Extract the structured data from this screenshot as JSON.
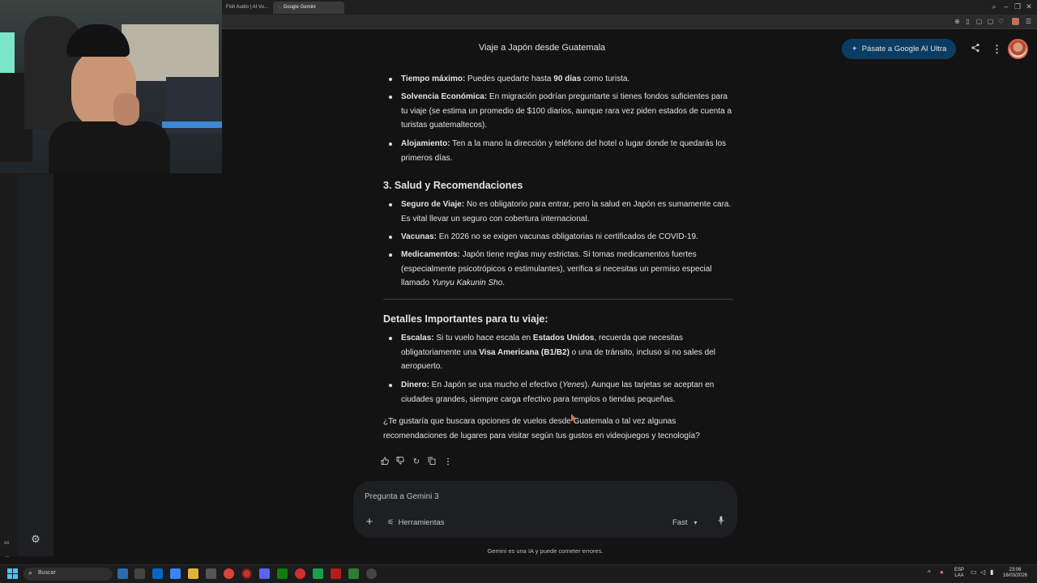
{
  "browser": {
    "tabs": [
      {
        "label": "Fish Audio | AI Vo..."
      },
      {
        "label": "Google Gemini"
      }
    ]
  },
  "header": {
    "conversation_title": "Viaje a Japón desde Guatemala",
    "upgrade_label": "Pásate a Google AI Ultra"
  },
  "content": {
    "bullets_a": [
      {
        "strong": "Tiempo máximo:",
        "pre": " Puedes quedarte hasta ",
        "strong2": "90 días",
        "post": " como turista."
      },
      {
        "strong": "Solvencia Económica:",
        "text": " En migración podrían preguntarte si tienes fondos suficientes para tu viaje (se estima un promedio de $100 diarios, aunque rara vez piden estados de cuenta a turistas guatemaltecos)."
      },
      {
        "strong": "Alojamiento:",
        "text": " Ten a la mano la dirección y teléfono del hotel o lugar donde te quedarás los primeros días."
      }
    ],
    "section3_title": "3. Salud y Recomendaciones",
    "bullets_b": [
      {
        "strong": "Seguro de Viaje:",
        "text": " No es obligatorio para entrar, pero la salud en Japón es sumamente cara. Es vital llevar un seguro con cobertura internacional."
      },
      {
        "strong": "Vacunas:",
        "text": " En 2026 no se exigen vacunas obligatorias ni certificados de COVID-19."
      },
      {
        "strong": "Medicamentos:",
        "text": " Japón tiene reglas muy estrictas. Si tomas medicamentos fuertes (especialmente psicotrópicos o estimulantes), verifica si necesitas un permiso especial llamado ",
        "em": "Yunyu Kakunin Sho",
        "post": "."
      }
    ],
    "details_title": "Detalles Importantes para tu viaje:",
    "bullets_c": [
      {
        "strong": "Escalas:",
        "pre": " Si tu vuelo hace escala en ",
        "strong2": "Estados Unidos",
        "mid": ", recuerda que necesitas obligatoriamente una ",
        "strong3": "Visa Americana (B1/B2)",
        "post": " o una de tránsito, incluso si no sales del aeropuerto."
      },
      {
        "strong": "Dinero:",
        "pre": " En Japón se usa mucho el efectivo (",
        "em": "Yenes",
        "post": "). Aunque las tarjetas se aceptan en ciudades grandes, siempre carga efectivo para templos o tiendas pequeñas."
      }
    ],
    "closing": "¿Te gustaría que buscara opciones de vuelos desde Guatemala o tal vez algunas recomendaciones de lugares para visitar según tus gustos en videojuegos y tecnología?"
  },
  "prompt": {
    "placeholder": "Pregunta a Gemini 3",
    "tools_label": "Herramientas",
    "model_label": "Fast"
  },
  "disclaimer": "Gemini es una IA y puede cometer errores.",
  "sidebar": {
    "small_top": "ox",
    "small_bottom": "..."
  },
  "taskbar": {
    "search_label": "Buscar",
    "lang_top": "ESP",
    "lang_bottom": "LAA",
    "time": "23:06",
    "date": "16/03/2026"
  }
}
